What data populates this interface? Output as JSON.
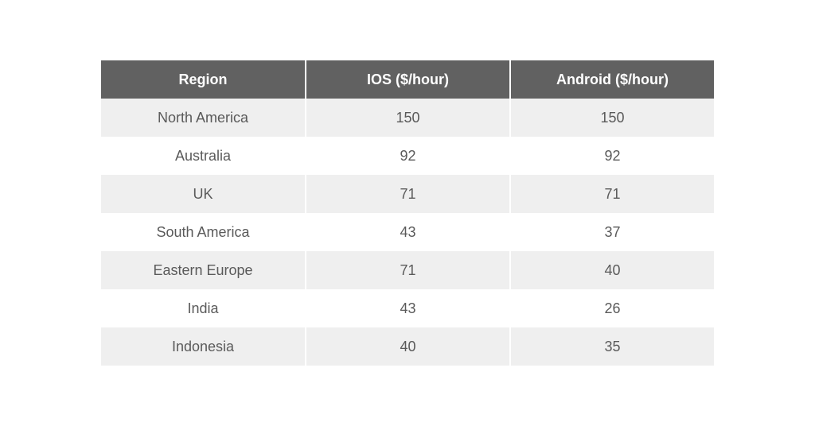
{
  "table": {
    "headers": [
      "Region",
      "IOS ($/hour)",
      "Android ($/hour)"
    ],
    "rows": [
      [
        "North America",
        "150",
        "150"
      ],
      [
        "Australia",
        "92",
        "92"
      ],
      [
        "UK",
        "71",
        "71"
      ],
      [
        "South America",
        "43",
        "37"
      ],
      [
        "Eastern Europe",
        "71",
        "40"
      ],
      [
        "India",
        "43",
        "26"
      ],
      [
        "Indonesia",
        "40",
        "35"
      ]
    ]
  },
  "colors": {
    "header_bg": "#616161",
    "stripe_bg": "#efefef",
    "text": "#5a5a5a"
  }
}
